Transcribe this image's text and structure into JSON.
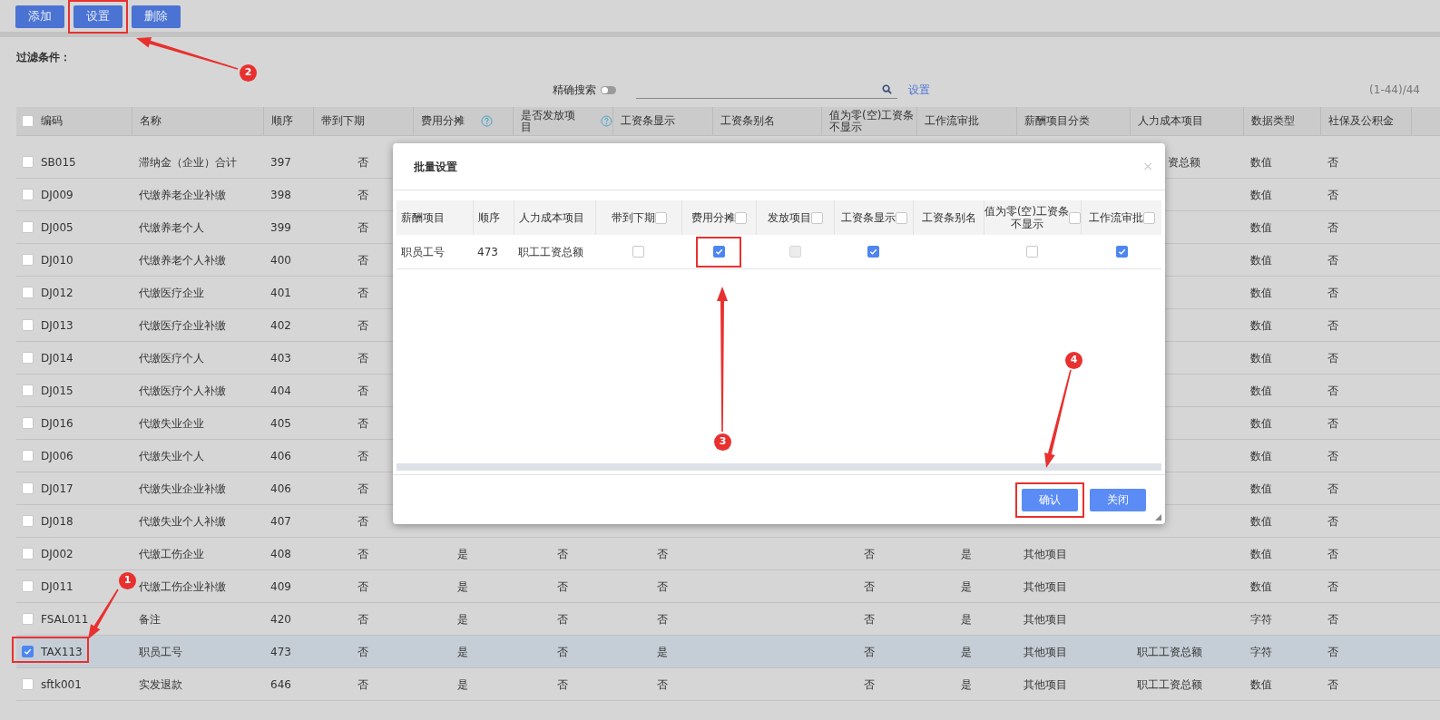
{
  "toolbar": {
    "buttons": [
      {
        "label": "添加",
        "highlighted": false
      },
      {
        "label": "设置",
        "highlighted": true
      },
      {
        "label": "删除",
        "highlighted": false
      }
    ]
  },
  "filter": {
    "title": "过滤条件：",
    "exact_search": {
      "label": "精确搜索",
      "on": false
    },
    "settings_link": "设置",
    "count": "(1-44)/44"
  },
  "table": {
    "header_checked": false,
    "columns": [
      {
        "label": "编码",
        "help": false
      },
      {
        "label": "名称",
        "help": false
      },
      {
        "label": "顺序",
        "help": false
      },
      {
        "label": "带到下期",
        "help": false
      },
      {
        "label": "费用分摊",
        "help": true
      },
      {
        "label": "是否发放项目",
        "help": true
      },
      {
        "label": "工资条显示",
        "help": false
      },
      {
        "label": "工资条别名",
        "help": false
      },
      {
        "label": "值为零(空)工资条不显示",
        "help": false
      },
      {
        "label": "工作流审批",
        "help": false
      },
      {
        "label": "薪酬项目分类",
        "help": false
      },
      {
        "label": "人力成本项目",
        "help": false
      },
      {
        "label": "数据类型",
        "help": false
      },
      {
        "label": "社保及公积金",
        "help": false
      }
    ],
    "rows": [
      {
        "checked": false,
        "selected": false,
        "cells": [
          "SB015",
          "滞纳金（企业）合计",
          "397",
          "否",
          null,
          null,
          null,
          null,
          null,
          null,
          null,
          "资总额",
          "数值",
          "否"
        ]
      },
      {
        "checked": false,
        "selected": false,
        "cells": [
          "DJ009",
          "代缴养老企业补缴",
          "398",
          "否",
          null,
          null,
          null,
          null,
          null,
          null,
          null,
          null,
          "数值",
          "否"
        ]
      },
      {
        "checked": false,
        "selected": false,
        "cells": [
          "DJ005",
          "代缴养老个人",
          "399",
          "否",
          null,
          null,
          null,
          null,
          null,
          null,
          null,
          null,
          "数值",
          "否"
        ]
      },
      {
        "checked": false,
        "selected": false,
        "cells": [
          "DJ010",
          "代缴养老个人补缴",
          "400",
          "否",
          null,
          null,
          null,
          null,
          null,
          null,
          null,
          null,
          "数值",
          "否"
        ]
      },
      {
        "checked": false,
        "selected": false,
        "cells": [
          "DJ012",
          "代缴医疗企业",
          "401",
          "否",
          null,
          null,
          null,
          null,
          null,
          null,
          null,
          null,
          "数值",
          "否"
        ]
      },
      {
        "checked": false,
        "selected": false,
        "cells": [
          "DJ013",
          "代缴医疗企业补缴",
          "402",
          "否",
          null,
          null,
          null,
          null,
          null,
          null,
          null,
          null,
          "数值",
          "否"
        ]
      },
      {
        "checked": false,
        "selected": false,
        "cells": [
          "DJ014",
          "代缴医疗个人",
          "403",
          "否",
          null,
          null,
          null,
          null,
          null,
          null,
          null,
          null,
          "数值",
          "否"
        ]
      },
      {
        "checked": false,
        "selected": false,
        "cells": [
          "DJ015",
          "代缴医疗个人补缴",
          "404",
          "否",
          null,
          null,
          null,
          null,
          null,
          null,
          null,
          null,
          "数值",
          "否"
        ]
      },
      {
        "checked": false,
        "selected": false,
        "cells": [
          "DJ016",
          "代缴失业企业",
          "405",
          "否",
          null,
          null,
          null,
          null,
          null,
          null,
          null,
          null,
          "数值",
          "否"
        ]
      },
      {
        "checked": false,
        "selected": false,
        "cells": [
          "DJ006",
          "代缴失业个人",
          "406",
          "否",
          null,
          null,
          null,
          null,
          null,
          null,
          null,
          null,
          "数值",
          "否"
        ]
      },
      {
        "checked": false,
        "selected": false,
        "cells": [
          "DJ017",
          "代缴失业企业补缴",
          "406",
          "否",
          null,
          null,
          null,
          null,
          null,
          null,
          null,
          null,
          "数值",
          "否"
        ]
      },
      {
        "checked": false,
        "selected": false,
        "cells": [
          "DJ018",
          "代缴失业个人补缴",
          "407",
          "否",
          null,
          null,
          null,
          null,
          null,
          null,
          null,
          null,
          "数值",
          "否"
        ]
      },
      {
        "checked": false,
        "selected": false,
        "cells": [
          "DJ002",
          "代缴工伤企业",
          "408",
          "否",
          "是",
          "否",
          "否",
          null,
          "否",
          "是",
          "其他项目",
          null,
          "数值",
          "否"
        ]
      },
      {
        "checked": false,
        "selected": false,
        "cells": [
          "DJ011",
          "代缴工伤企业补缴",
          "409",
          "否",
          "是",
          "否",
          "否",
          null,
          "否",
          "是",
          "其他项目",
          null,
          "数值",
          "否"
        ]
      },
      {
        "checked": false,
        "selected": false,
        "cells": [
          "FSAL011",
          "备注",
          "420",
          "否",
          "是",
          "否",
          "否",
          null,
          "否",
          "是",
          "其他项目",
          null,
          "字符",
          "否"
        ]
      },
      {
        "checked": true,
        "selected": true,
        "cells": [
          "TAX113",
          "职员工号",
          "473",
          "否",
          "是",
          "否",
          "是",
          null,
          "否",
          "是",
          "其他项目",
          "职工工资总额",
          "字符",
          "否"
        ]
      },
      {
        "checked": false,
        "selected": false,
        "cells": [
          "sftk001",
          "实发退款",
          "646",
          "否",
          "是",
          "否",
          "否",
          null,
          "否",
          "是",
          "其他项目",
          "职工工资总额",
          "数值",
          "否"
        ]
      }
    ]
  },
  "dialog": {
    "title": "批量设置",
    "close": "×",
    "columns": [
      {
        "label": "薪酬项目"
      },
      {
        "label": "顺序"
      },
      {
        "label": "人力成本项目"
      },
      {
        "label": "带到下期",
        "header_checked": false
      },
      {
        "label": "费用分摊",
        "header_checked": false
      },
      {
        "label": "发放项目",
        "header_checked": false
      },
      {
        "label": "工资条显示",
        "header_checked": false
      },
      {
        "label": "工资条别名"
      },
      {
        "label": "值为零(空)工资条不显示",
        "header_checked": false
      },
      {
        "label": "工作流审批",
        "header_checked": false
      }
    ],
    "rows": [
      {
        "cells": [
          {
            "kind": "text",
            "text": "职员工号"
          },
          {
            "kind": "text",
            "text": "473"
          },
          {
            "kind": "text",
            "text": "职工工资总额"
          },
          {
            "kind": "check",
            "checked": false,
            "disabled": false,
            "highlighted": false
          },
          {
            "kind": "check",
            "checked": true,
            "disabled": false,
            "highlighted": true
          },
          {
            "kind": "check",
            "checked": false,
            "disabled": true,
            "highlighted": false
          },
          {
            "kind": "check",
            "checked": true,
            "disabled": false,
            "highlighted": false
          },
          {
            "kind": "blank"
          },
          {
            "kind": "check",
            "checked": false,
            "disabled": false,
            "highlighted": false
          },
          {
            "kind": "check",
            "checked": true,
            "disabled": false,
            "highlighted": false
          }
        ]
      }
    ],
    "buttons": [
      {
        "label": "确认",
        "highlighted": true
      },
      {
        "label": "关闭",
        "highlighted": false
      }
    ]
  },
  "annotations": [
    {
      "label": "1"
    },
    {
      "label": "2"
    },
    {
      "label": "3"
    },
    {
      "label": "4"
    }
  ]
}
